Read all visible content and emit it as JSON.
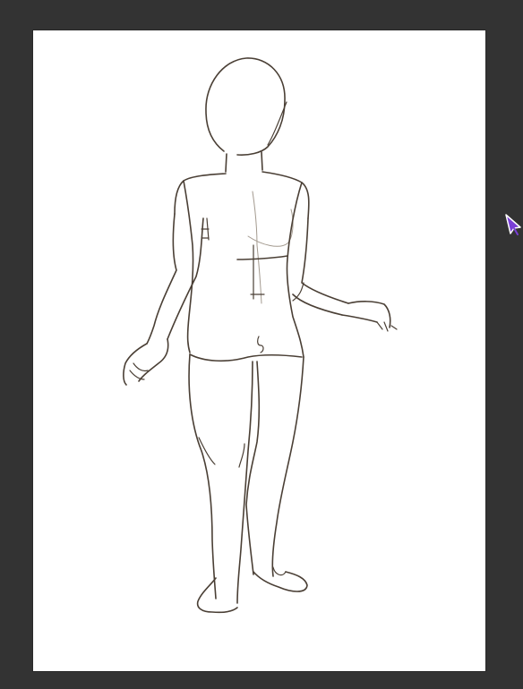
{
  "app": {
    "workspace_color": "#333333",
    "canvas_color": "#ffffff",
    "ink_color": "#4a3f35",
    "cursor_color": "#7a3fd6"
  },
  "canvas": {
    "content": "figure-sketch"
  },
  "cursor": {
    "icon": "pen-cursor-icon"
  }
}
